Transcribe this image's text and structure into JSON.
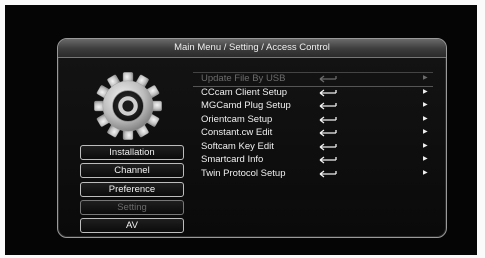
{
  "header": {
    "title": "Main Menu / Setting / Access Control"
  },
  "left_menu": {
    "items": [
      {
        "label": "Installation"
      },
      {
        "label": "Channel"
      },
      {
        "label": "Preference"
      },
      {
        "label": "Setting"
      },
      {
        "label": "AV"
      }
    ],
    "selected": "Setting"
  },
  "right_menu": {
    "items": [
      {
        "label": "Update File By USB",
        "state": "disabled"
      },
      {
        "label": "CCcam Client Setup"
      },
      {
        "label": "MGCamd Plug Setup"
      },
      {
        "label": "Orientcam Setup"
      },
      {
        "label": "Constant.cw Edit"
      },
      {
        "label": "Softcam Key Edit"
      },
      {
        "label": "Smartcard Info"
      },
      {
        "label": "Twin Protocol Setup"
      }
    ],
    "enter_icon": "enter-arrow-icon",
    "submenu_icon": "chevron-right-icon"
  },
  "colors": {
    "background": "#050505",
    "title_bar": "#4a4a4a",
    "border": "#9a9a9a",
    "text": "#f0f0f0",
    "disabled_text": "#6c6c6c"
  }
}
